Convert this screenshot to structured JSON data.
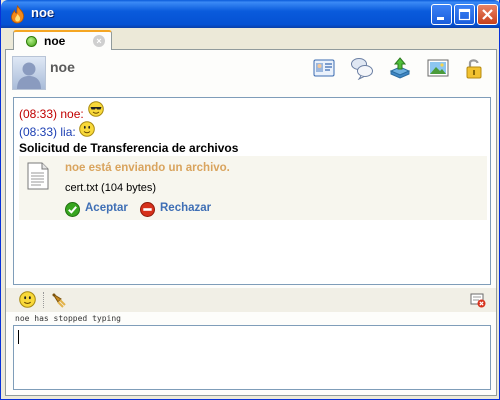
{
  "window": {
    "title": "noe"
  },
  "tab": {
    "label": "noe"
  },
  "contact": {
    "name": "noe"
  },
  "toolbar_icons": [
    "contact-card-icon",
    "chat-bubbles-icon",
    "send-file-icon",
    "picture-icon",
    "padlock-icon"
  ],
  "messages": [
    {
      "time": "(08:33)",
      "sender": "noe:",
      "emoticon": "cool-smiley-icon"
    },
    {
      "time": "(08:33)",
      "sender": "lia:",
      "emoticon": "smiley-icon"
    }
  ],
  "file_transfer": {
    "title": "Solicitud de Transferencia de archivos",
    "status": "noe está enviando un archivo.",
    "file": "cert.txt (104 bytes)",
    "accept_label": "Aceptar",
    "reject_label": "Rechazar"
  },
  "composer": {
    "typing_status": "noe has stopped typing",
    "input_value": ""
  },
  "colors": {
    "titlebar": "#0551d3",
    "sender_noe": "#c00000",
    "sender_lia": "#1c3fb3",
    "transfer_status": "#d9a45e",
    "link": "#3f6fb5"
  }
}
